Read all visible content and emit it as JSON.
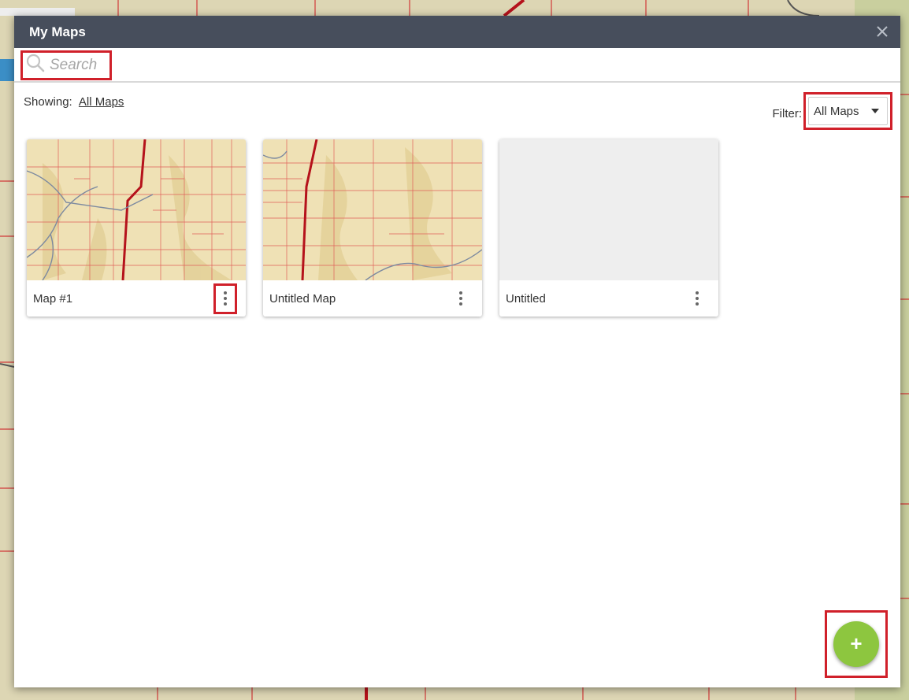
{
  "modal": {
    "title": "My Maps",
    "close_icon": "close-icon"
  },
  "search": {
    "placeholder": "Search",
    "icon": "search-icon"
  },
  "toolbar": {
    "showing_label": "Showing:",
    "showing_value": "All Maps",
    "filter_label": "Filter:",
    "filter_value": "All Maps"
  },
  "maps": [
    {
      "title": "Map #1",
      "thumbnail": "topo-map"
    },
    {
      "title": "Untitled Map",
      "thumbnail": "topo-map"
    },
    {
      "title": "Untitled",
      "thumbnail": "blank"
    }
  ],
  "fab": {
    "label": "+"
  },
  "colors": {
    "header": "#474e5c",
    "highlight": "#d0202a",
    "fab": "#8dc63f"
  }
}
